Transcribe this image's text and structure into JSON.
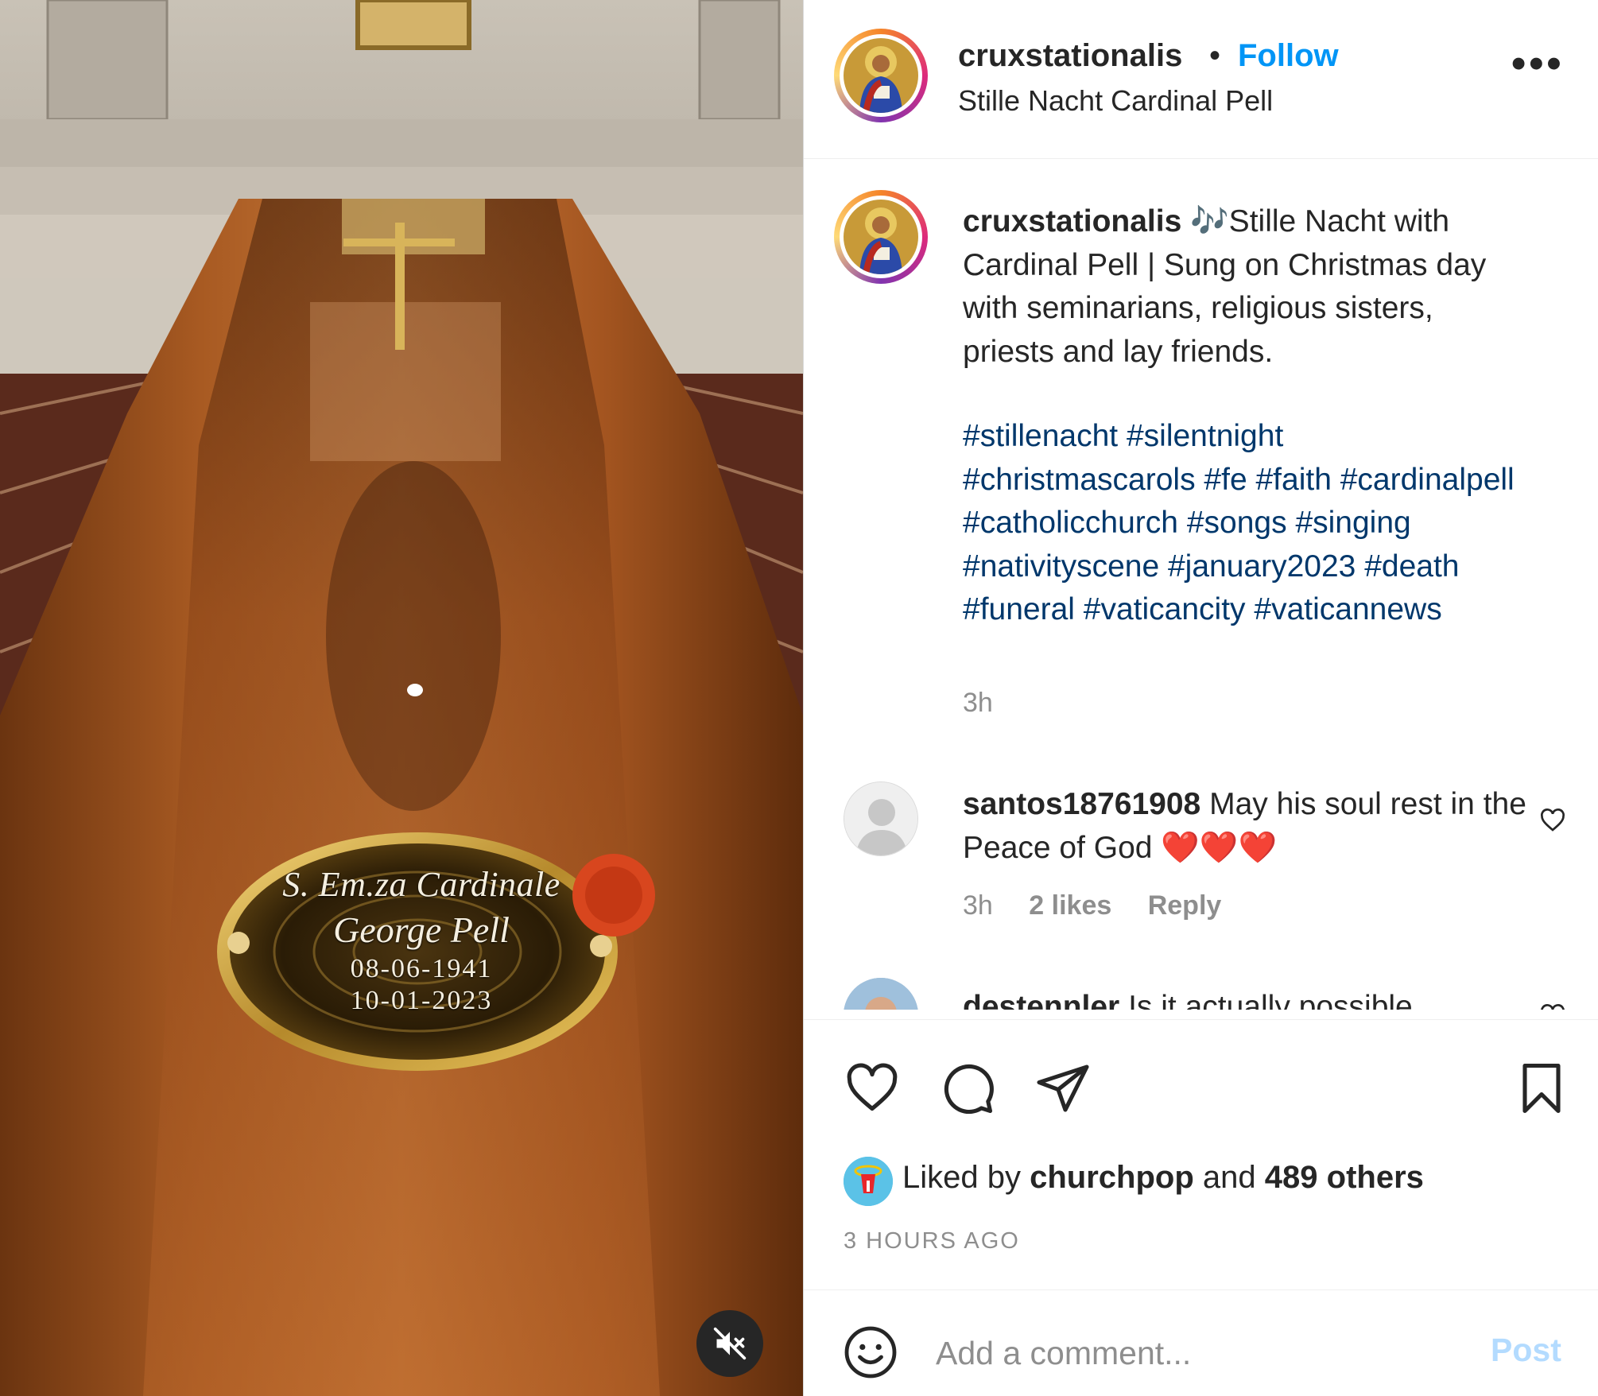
{
  "media": {
    "plaque": {
      "line1": "S. Em.za Cardinale",
      "line2": "George Pell",
      "date1": "08-06-1941",
      "date2": "10-01-2023"
    },
    "mute_icon": "speaker-muted-icon"
  },
  "header": {
    "username": "cruxstationalis",
    "separator": "•",
    "follow_label": "Follow",
    "subtitle": "Stille Nacht Cardinal Pell",
    "more_label": "•••"
  },
  "caption": {
    "username": "cruxstationalis",
    "text": "🎶Stille Nacht with Cardinal Pell | Sung on Christmas day with seminarians, religious sisters, priests and lay friends.",
    "hashtags": [
      "#stillenacht",
      "#silentnight",
      "#christmascarols",
      "#fe",
      "#faith",
      "#cardinalpell",
      "#catholicchurch",
      "#songs",
      "#singing",
      "#nativityscene",
      "#january2023",
      "#death",
      "#funeral",
      "#vaticancity",
      "#vaticannews"
    ],
    "time": "3h"
  },
  "comments": [
    {
      "username": "santos18761908",
      "text": "May his soul rest in the Peace of God ❤️❤️❤️",
      "time": "3h",
      "likes": "2 likes",
      "reply_label": "Reply"
    },
    {
      "username": "destennler",
      "text": "Is it actually possible"
    }
  ],
  "actions": {
    "liked_prefix": "Liked by",
    "liked_user": "churchpop",
    "liked_and": "and",
    "liked_others": "489 others",
    "timestamp": "3 HOURS AGO"
  },
  "add_comment": {
    "placeholder": "Add a comment...",
    "post_label": "Post"
  },
  "colors": {
    "link_blue": "#0095f6",
    "hashtag": "#00376b",
    "muted": "#8e8e8e",
    "post_disabled": "#b3dbff"
  }
}
